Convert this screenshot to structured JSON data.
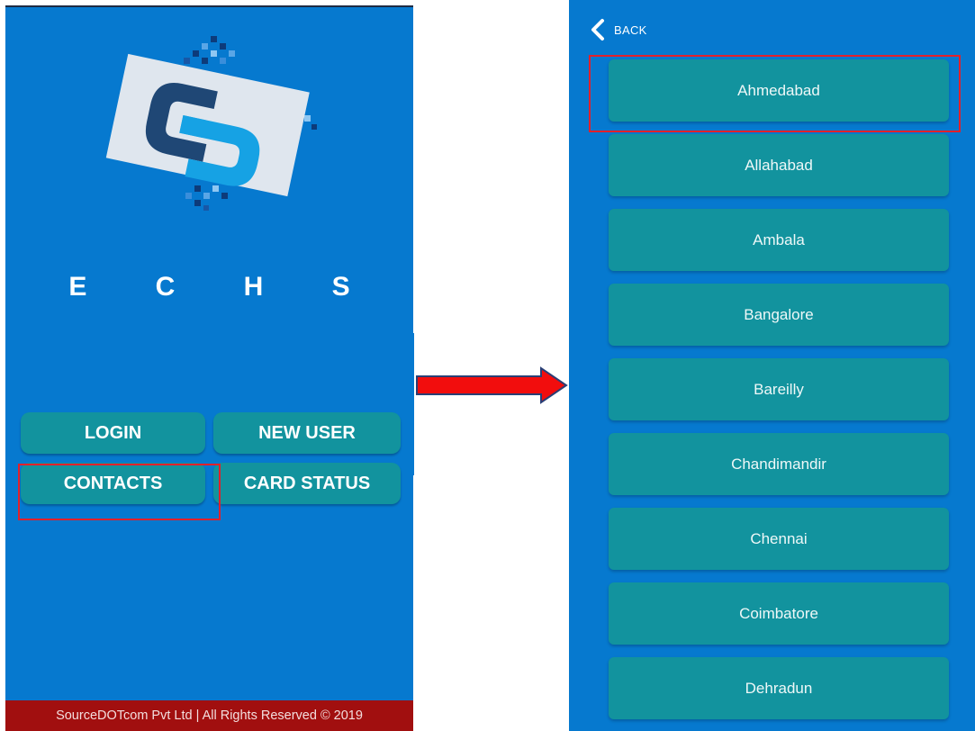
{
  "home": {
    "brand": "E C H S",
    "buttons": {
      "login": "LOGIN",
      "new_user": "NEW USER",
      "contacts": "CONTACTS",
      "card_status": "CARD STATUS"
    },
    "footer": "SourceDOTcom Pvt Ltd | All Rights Reserved © 2019",
    "logo_icon": "sourcedotcom-logo-icon"
  },
  "contacts": {
    "back_label": "BACK",
    "back_icon": "chevron-left-icon",
    "cities": [
      "Ahmedabad",
      "Allahabad",
      "Ambala",
      "Bangalore",
      "Bareilly",
      "Chandimandir",
      "Chennai",
      "Coimbatore",
      "Dehradun"
    ]
  },
  "annotations": {
    "arrow_icon": "arrow-right-icon",
    "highlight_color": "#e3202a"
  },
  "colors": {
    "screen_bg": "#0679cf",
    "button_bg": "#12939e",
    "footer_bg": "#a10f0f"
  }
}
